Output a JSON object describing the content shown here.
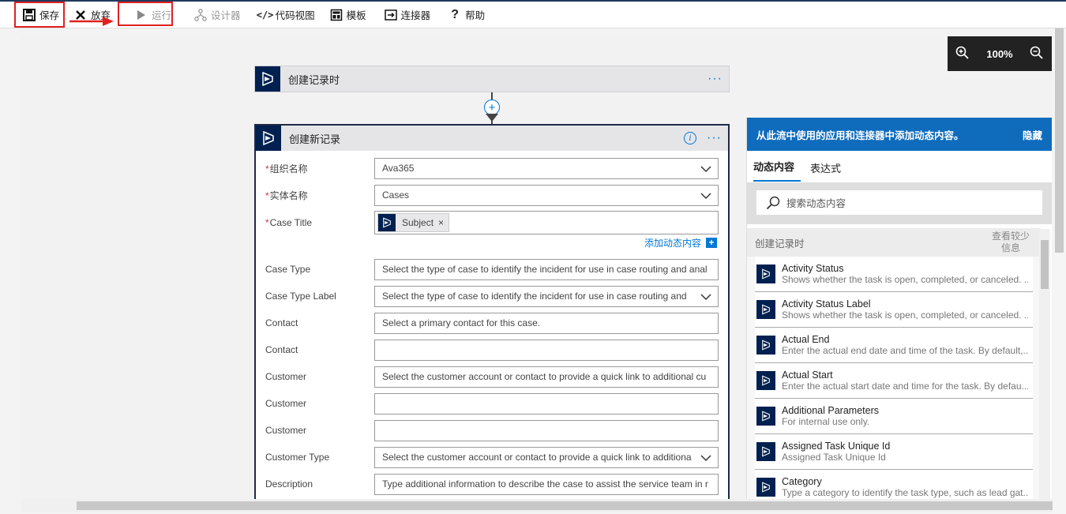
{
  "toolbar": {
    "save": "保存",
    "discard": "放弃",
    "run": "运行",
    "designer": "设计器",
    "code_view": "代码视图",
    "templates": "模板",
    "connectors": "连接器",
    "help": "帮助"
  },
  "zoom": {
    "level": "100%"
  },
  "trigger_card": {
    "title": "创建记录时",
    "more": "···"
  },
  "action_card": {
    "title": "创建新记录",
    "more": "···",
    "add_dynamic": "添加动态内容",
    "fields": [
      {
        "label": "组织名称",
        "required": "*",
        "value": "Ava365",
        "placeholder": ""
      },
      {
        "label": "实体名称",
        "required": "*",
        "value": "Cases",
        "placeholder": ""
      },
      {
        "label": "Case Title",
        "required": "*",
        "value": "",
        "token": "Subject",
        "token_remove": "×"
      },
      {
        "label": "Case Type",
        "value": "",
        "placeholder": "Select the type of case to identify the incident for use in case routing and anal"
      },
      {
        "label": "Case Type Label",
        "value": "",
        "placeholder": "Select the type of case to identify the incident for use in case routing and"
      },
      {
        "label": "Contact",
        "value": "",
        "placeholder": "Select a primary contact for this case."
      },
      {
        "label": "Contact",
        "value": "",
        "placeholder": ""
      },
      {
        "label": "Customer",
        "value": "",
        "placeholder": "Select the customer account or contact to provide a quick link to additional cu"
      },
      {
        "label": "Customer",
        "value": "",
        "placeholder": ""
      },
      {
        "label": "Customer",
        "value": "",
        "placeholder": ""
      },
      {
        "label": "Customer Type",
        "value": "",
        "placeholder": "Select the customer account or contact to provide a quick link to additiona"
      },
      {
        "label": "Description",
        "value": "",
        "placeholder": "Type additional information to describe the case to assist the service team in r"
      }
    ]
  },
  "dynamic_panel": {
    "header": "从此流中使用的应用和连接器中添加动态内容。",
    "hide": "隐藏",
    "tabs": [
      "动态内容",
      "表达式"
    ],
    "search_placeholder": "搜索动态内容",
    "section_title": "创建记录时",
    "section_more": "查看较少信息",
    "items": [
      {
        "title": "Activity Status",
        "desc": "Shows whether the task is open, completed, or canceled. ..."
      },
      {
        "title": "Activity Status Label",
        "desc": "Shows whether the task is open, completed, or canceled. ..."
      },
      {
        "title": "Actual End",
        "desc": "Enter the actual end date and time of the task. By default,..."
      },
      {
        "title": "Actual Start",
        "desc": "Enter the actual start date and time for the task. By defau..."
      },
      {
        "title": "Additional Parameters",
        "desc": "For internal use only."
      },
      {
        "title": "Assigned Task Unique Id",
        "desc": "Assigned Task Unique Id"
      },
      {
        "title": "Category",
        "desc": "Type a category to identify the task type, such as lead gat..."
      }
    ]
  }
}
